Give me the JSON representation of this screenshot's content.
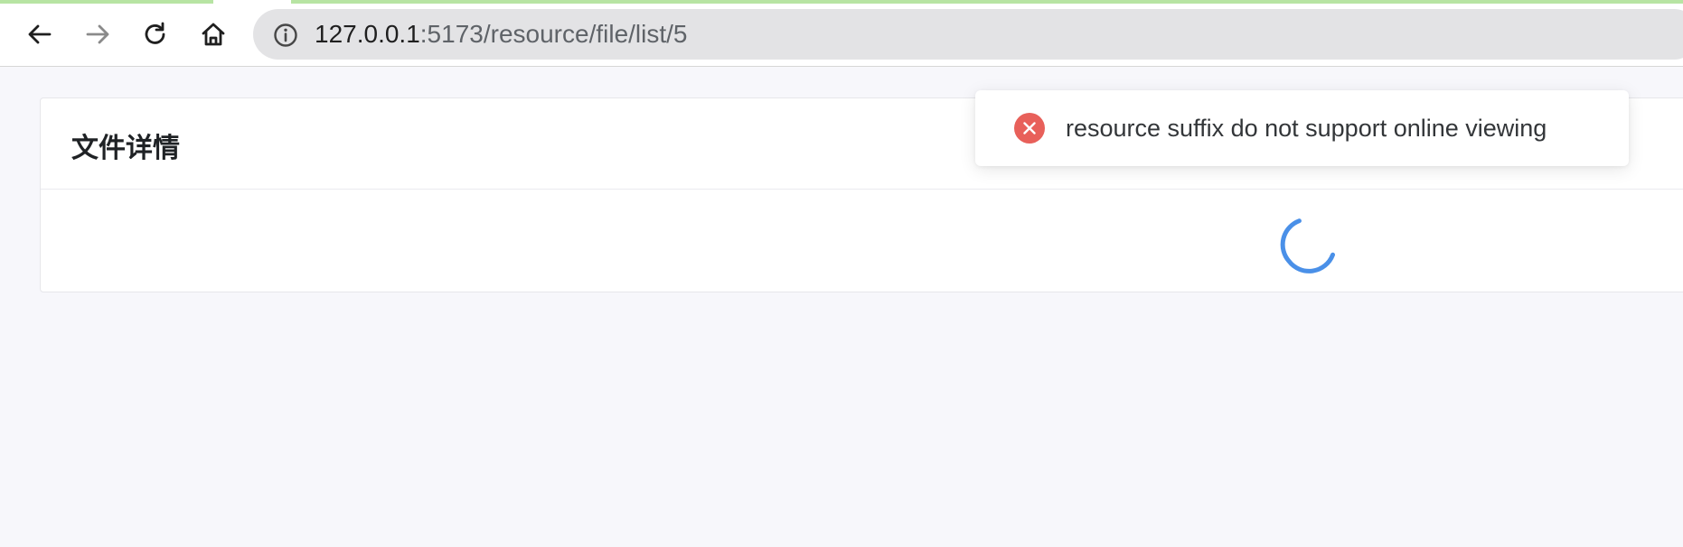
{
  "browser": {
    "url_host": "127.0.0.1",
    "url_rest": ":5173/resource/file/list/5",
    "icons": {
      "back": "arrow-left-icon",
      "forward": "arrow-right-icon",
      "reload": "reload-icon",
      "home": "home-icon",
      "site_info": "info-icon"
    }
  },
  "page": {
    "card_title": "文件详情",
    "loading": true
  },
  "toast": {
    "type": "error",
    "icon": "error-circle-icon",
    "message": "resource suffix do not support online viewing"
  },
  "colors": {
    "error": "#e8605a",
    "spinner": "#4a90e8",
    "page_background": "#f7f7fb"
  }
}
